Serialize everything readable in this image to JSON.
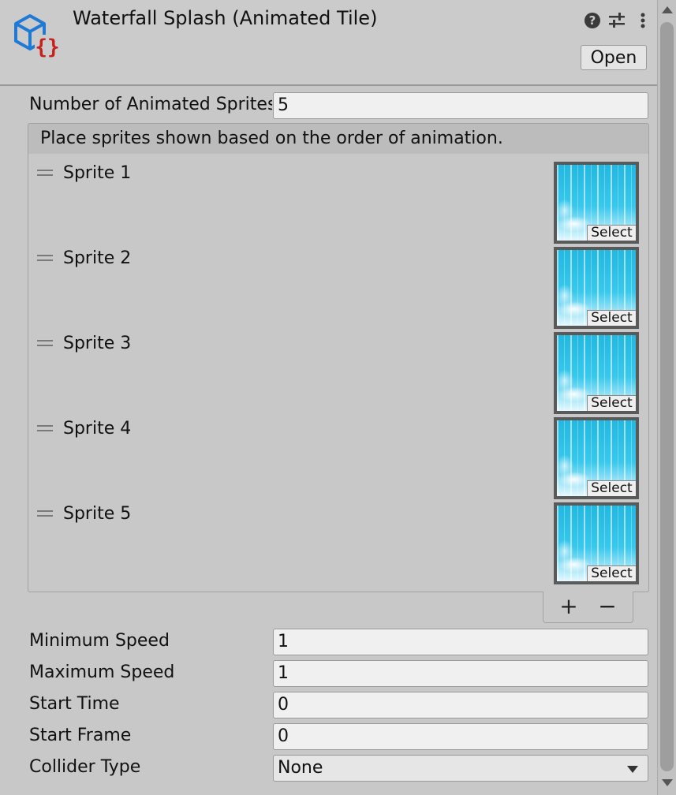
{
  "header": {
    "title": "Waterfall Splash (Animated Tile)",
    "open_label": "Open",
    "icons": [
      "scriptable-object-icon",
      "help-icon",
      "preset-sliders-icon",
      "kebab-menu-icon"
    ]
  },
  "fields": {
    "num_sprites": {
      "label": "Number of Animated Sprites",
      "value": "5"
    },
    "min_speed": {
      "label": "Minimum Speed",
      "value": "1"
    },
    "max_speed": {
      "label": "Maximum Speed",
      "value": "1"
    },
    "start_time": {
      "label": "Start Time",
      "value": "0"
    },
    "start_frame": {
      "label": "Start Frame",
      "value": "0"
    },
    "collider_type": {
      "label": "Collider Type",
      "value": "None"
    }
  },
  "list": {
    "header": "Place sprites shown based on the order of animation.",
    "select_label": "Select",
    "items": [
      {
        "label": "Sprite 1"
      },
      {
        "label": "Sprite 2"
      },
      {
        "label": "Sprite 3"
      },
      {
        "label": "Sprite 4"
      },
      {
        "label": "Sprite 5"
      }
    ],
    "add_label": "+",
    "remove_label": "−"
  },
  "colors": {
    "background": "#c8c8c8",
    "icon_blue": "#1f7ad6",
    "icon_red": "#c8201c"
  }
}
